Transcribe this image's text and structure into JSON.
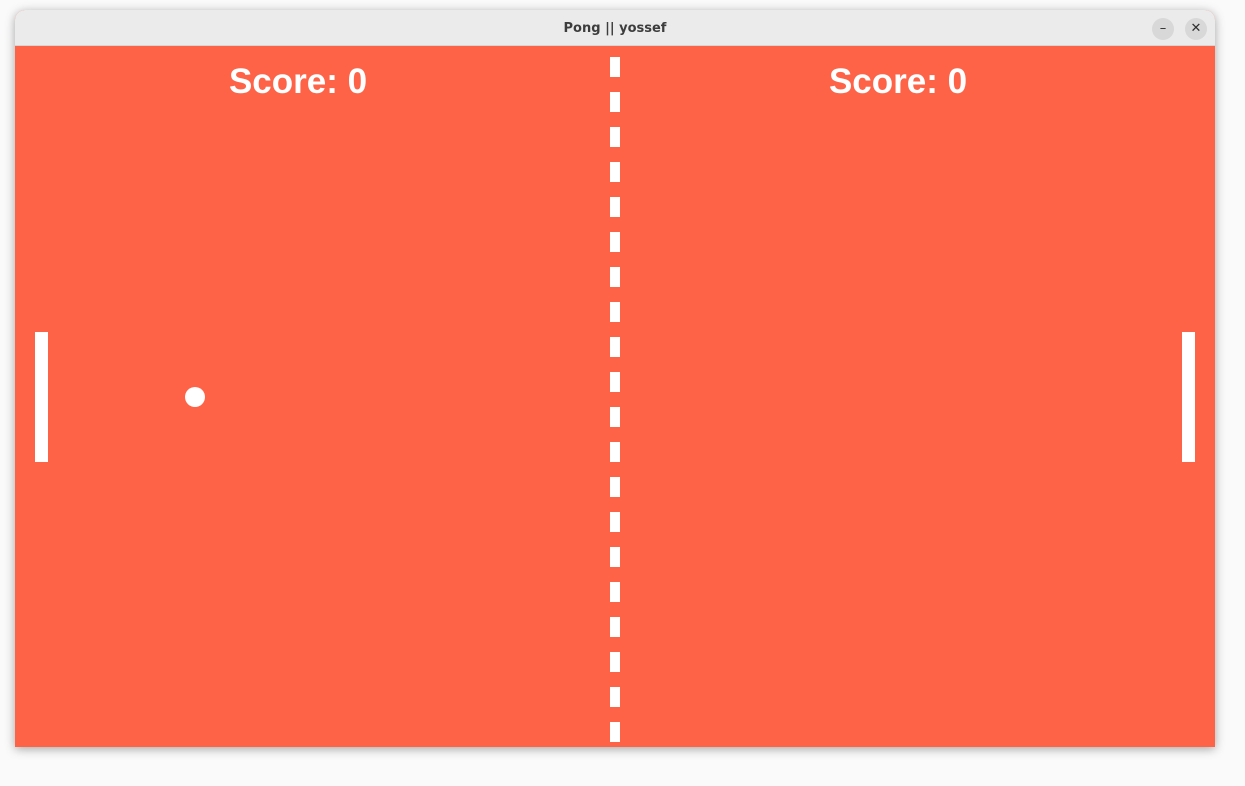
{
  "window": {
    "title": "Pong || yossef",
    "minimize_label": "–",
    "close_label": "✕"
  },
  "game": {
    "background_color": "#ff6347",
    "foreground_color": "#ffffff",
    "left_score_text": "Score: 0",
    "right_score_text": "Score: 0",
    "left_score": 0,
    "right_score": 0
  }
}
